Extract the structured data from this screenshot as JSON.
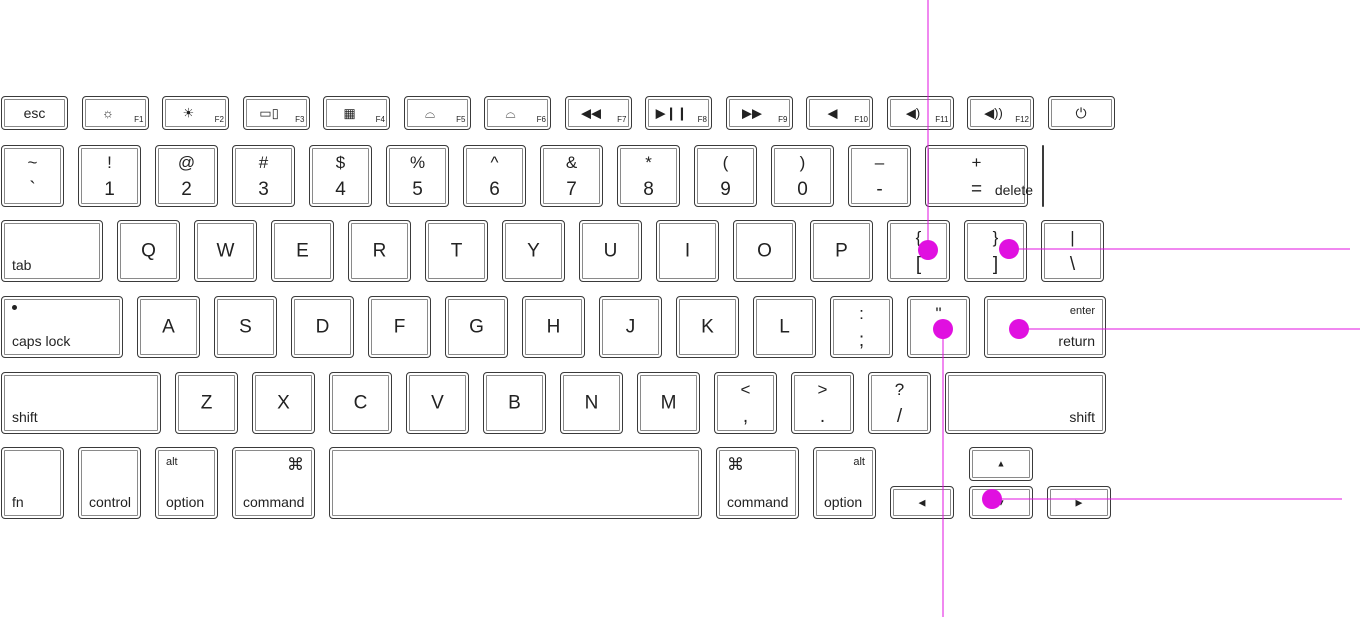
{
  "colors": {
    "annotation": "#e010e0",
    "key_border": "#3a3a3a"
  },
  "rows": [
    [
      {
        "id": "esc",
        "main": "esc"
      },
      {
        "id": "f1",
        "icon": "☼",
        "fn": "F1",
        "icon_name": "brightness-down-icon"
      },
      {
        "id": "f2",
        "icon": "☀",
        "fn": "F2",
        "icon_name": "brightness-up-icon"
      },
      {
        "id": "f3",
        "icon": "▭▯",
        "fn": "F3",
        "icon_name": "mission-control-icon"
      },
      {
        "id": "f4",
        "icon": "▦",
        "fn": "F4",
        "icon_name": "launchpad-icon"
      },
      {
        "id": "f5",
        "icon": "⌓",
        "fn": "F5",
        "icon_name": "keyboard-light-down-icon"
      },
      {
        "id": "f6",
        "icon": "⌓",
        "fn": "F6",
        "icon_name": "keyboard-light-up-icon"
      },
      {
        "id": "f7",
        "icon": "◀◀",
        "fn": "F7",
        "icon_name": "rewind-icon"
      },
      {
        "id": "f8",
        "icon": "▶❙❙",
        "fn": "F8",
        "icon_name": "play-pause-icon"
      },
      {
        "id": "f9",
        "icon": "▶▶",
        "fn": "F9",
        "icon_name": "fast-forward-icon"
      },
      {
        "id": "f10",
        "icon": "◀",
        "fn": "F10",
        "icon_name": "mute-icon"
      },
      {
        "id": "f11",
        "icon": "◀)",
        "fn": "F11",
        "icon_name": "volume-down-icon"
      },
      {
        "id": "f12",
        "icon": "◀))",
        "fn": "F12",
        "icon_name": "volume-up-icon"
      },
      {
        "id": "power",
        "icon": "⏻",
        "icon_name": "power-icon"
      }
    ],
    [
      {
        "id": "grave",
        "top": "~",
        "bottom": "`"
      },
      {
        "id": "1",
        "top": "!",
        "bottom": "1"
      },
      {
        "id": "2",
        "top": "@",
        "bottom": "2"
      },
      {
        "id": "3",
        "top": "#",
        "bottom": "3"
      },
      {
        "id": "4",
        "top": "$",
        "bottom": "4"
      },
      {
        "id": "5",
        "top": "%",
        "bottom": "5"
      },
      {
        "id": "6",
        "top": "^",
        "bottom": "6"
      },
      {
        "id": "7",
        "top": "&",
        "bottom": "7"
      },
      {
        "id": "8",
        "top": "*",
        "bottom": "8"
      },
      {
        "id": "9",
        "top": "(",
        "bottom": "9"
      },
      {
        "id": "0",
        "top": ")",
        "bottom": "0"
      },
      {
        "id": "minus",
        "top": "–",
        "bottom": "-"
      },
      {
        "id": "equal",
        "top": "+",
        "bottom": "="
      },
      {
        "id": "delete",
        "br": "delete"
      }
    ],
    [
      {
        "id": "tab",
        "bl": "tab"
      },
      {
        "id": "q",
        "main": "Q"
      },
      {
        "id": "w",
        "main": "W"
      },
      {
        "id": "e",
        "main": "E"
      },
      {
        "id": "r",
        "main": "R"
      },
      {
        "id": "t",
        "main": "T"
      },
      {
        "id": "y",
        "main": "Y"
      },
      {
        "id": "u",
        "main": "U"
      },
      {
        "id": "i",
        "main": "I"
      },
      {
        "id": "o",
        "main": "O"
      },
      {
        "id": "p",
        "main": "P"
      },
      {
        "id": "lbracket",
        "top": "{",
        "bottom": "["
      },
      {
        "id": "rbracket",
        "top": "}",
        "bottom": "]"
      },
      {
        "id": "backslash",
        "top": "|",
        "bottom": "\\"
      }
    ],
    [
      {
        "id": "capslock",
        "bl": "caps lock",
        "dot": true
      },
      {
        "id": "a",
        "main": "A"
      },
      {
        "id": "s",
        "main": "S"
      },
      {
        "id": "d",
        "main": "D"
      },
      {
        "id": "f",
        "main": "F"
      },
      {
        "id": "g",
        "main": "G"
      },
      {
        "id": "h",
        "main": "H"
      },
      {
        "id": "j",
        "main": "J"
      },
      {
        "id": "k",
        "main": "K"
      },
      {
        "id": "l",
        "main": "L"
      },
      {
        "id": "semicolon",
        "top": ":",
        "bottom": ";"
      },
      {
        "id": "quote",
        "top": "\"",
        "bottom": ""
      },
      {
        "id": "return",
        "tr": "enter",
        "br": "return"
      }
    ],
    [
      {
        "id": "lshift",
        "bl": "shift"
      },
      {
        "id": "z",
        "main": "Z"
      },
      {
        "id": "x",
        "main": "X"
      },
      {
        "id": "c",
        "main": "C"
      },
      {
        "id": "v",
        "main": "V"
      },
      {
        "id": "b",
        "main": "B"
      },
      {
        "id": "n",
        "main": "N"
      },
      {
        "id": "m",
        "main": "M"
      },
      {
        "id": "comma",
        "top": "<",
        "bottom": ","
      },
      {
        "id": "period",
        "top": ">",
        "bottom": "."
      },
      {
        "id": "slash",
        "top": "?",
        "bottom": "/"
      },
      {
        "id": "rshift",
        "br": "shift"
      }
    ],
    [
      {
        "id": "fn",
        "bl": "fn"
      },
      {
        "id": "control",
        "bl": "control"
      },
      {
        "id": "loption",
        "tl": "alt",
        "bl": "option"
      },
      {
        "id": "lcommand",
        "trg": "⌘",
        "bl": "command"
      },
      {
        "id": "space"
      },
      {
        "id": "rcommand",
        "tlg": "⌘",
        "bl": "command"
      },
      {
        "id": "roption",
        "tr": "alt",
        "bl": "option"
      },
      {
        "id": "left",
        "arrow": "◀"
      },
      {
        "id": "up",
        "arrow": "▲"
      },
      {
        "id": "down",
        "arrow": "▼"
      },
      {
        "id": "right",
        "arrow": "▶"
      }
    ]
  ]
}
